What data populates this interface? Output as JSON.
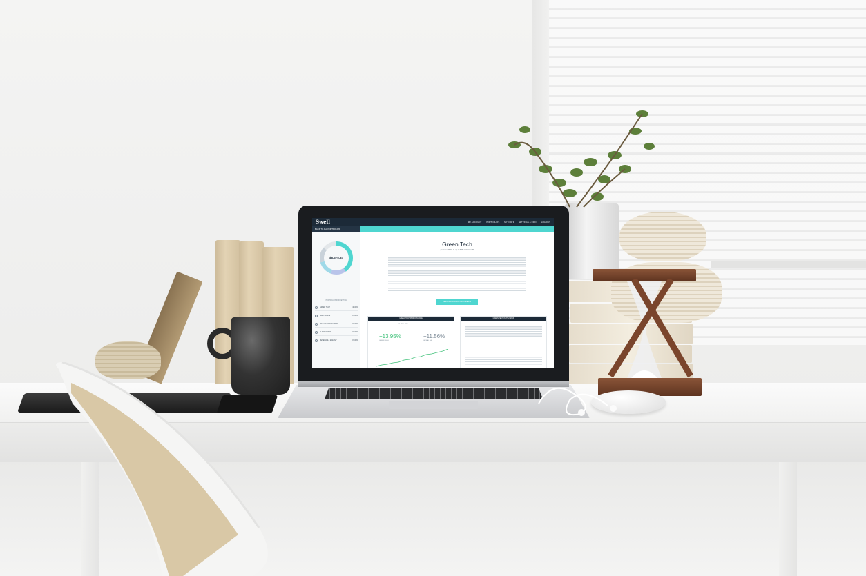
{
  "screen": {
    "logo": "Swell",
    "nav_items": [
      "MY ACCOUNT",
      "PORTFOLIOS",
      "MY FOR ▾",
      "SETTINGS & INFO",
      "LOG OUT"
    ],
    "back_link": "BACK TO ALL PORTFOLIOS",
    "portfolio_total": "$8,375.34",
    "sidebar_header": "PORTFOLIOS IN INVESTING",
    "sidebar_rows": [
      {
        "label": "GREEN TECH",
        "pct": "40.00%"
      },
      {
        "label": "ZERO WASTE",
        "pct": "15.00%"
      },
      {
        "label": "DISEASE ERADICATION",
        "pct": "15.00%"
      },
      {
        "label": "CLEAN WATER",
        "pct": "15.00%"
      },
      {
        "label": "RENEWABLE ENERGY",
        "pct": "15.00%"
      }
    ],
    "title": "Green Tech",
    "subtitle": "your portfolio is up 3.30% this month",
    "button_label": "SEE ALL PORTFOLIO INVESTMENTS",
    "card_left_title": "GREEN TECH PERFORMANCE",
    "card_left_range": "GLOBAL 2018",
    "metric_left": "+13.95%",
    "metric_left_label": "GREEN TECH",
    "metric_right": "+11.56%",
    "metric_right_label": "GLOBAL S&P",
    "card_right_title": "GREEN TECH IN THE NEWS",
    "accent_color": "#4fd6d0",
    "nav_color": "#1c2a38",
    "positive_color": "#41c17a"
  }
}
